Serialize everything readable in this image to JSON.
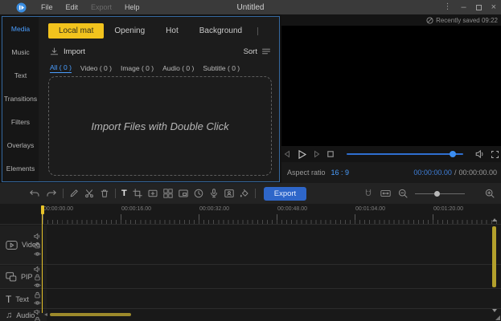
{
  "colors": {
    "accent_yellow": "#f2c31d",
    "accent_blue": "#4a9eff",
    "export_button_blue": "#2e66c9",
    "playhead_yellow": "#e6c229",
    "panel_focus_border": "#35689f"
  },
  "titlebar": {
    "title": "Untitled",
    "menus": [
      {
        "label": "File",
        "enabled": true
      },
      {
        "label": "Edit",
        "enabled": true
      },
      {
        "label": "Export",
        "enabled": false
      },
      {
        "label": "Help",
        "enabled": true
      }
    ]
  },
  "sidebar": {
    "items": [
      {
        "label": "Media",
        "active": true
      },
      {
        "label": "Music",
        "active": false
      },
      {
        "label": "Text",
        "active": false
      },
      {
        "label": "Transitions",
        "active": false
      },
      {
        "label": "Filters",
        "active": false
      },
      {
        "label": "Overlays",
        "active": false
      },
      {
        "label": "Elements",
        "active": false
      }
    ]
  },
  "media_panel": {
    "tabs": [
      {
        "label": "Local mat",
        "active": true
      },
      {
        "label": "Opening",
        "active": false
      },
      {
        "label": "Hot",
        "active": false
      },
      {
        "label": "Background",
        "active": false
      }
    ],
    "import_label": "Import",
    "sort_label": "Sort",
    "filters": [
      {
        "label": "All ( 0 )",
        "active": true
      },
      {
        "label": "Video ( 0 )",
        "active": false
      },
      {
        "label": "Image ( 0 )",
        "active": false
      },
      {
        "label": "Audio ( 0 )",
        "active": false
      },
      {
        "label": "Subtitle ( 0 )",
        "active": false
      }
    ],
    "dropzone_text": "Import Files with Double Click"
  },
  "preview": {
    "saved_status": "Recently saved 09:22",
    "aspect_ratio_label": "Aspect ratio",
    "aspect_ratio_value": "16 : 9",
    "current_time": "00:00:00.00",
    "time_separator": "/",
    "total_time": "00:00:00.00"
  },
  "toolbar": {
    "export_label": "Export"
  },
  "timeline": {
    "ruler_labels": [
      "00:00:00.00",
      "00:00:16.00",
      "00:00:32.00",
      "00:00:48.00",
      "00:01:04.00",
      "00:01:20.00"
    ],
    "tracks": [
      {
        "label": "Video"
      },
      {
        "label": "PIP"
      },
      {
        "label": "Text"
      },
      {
        "label": "Audio"
      }
    ]
  }
}
